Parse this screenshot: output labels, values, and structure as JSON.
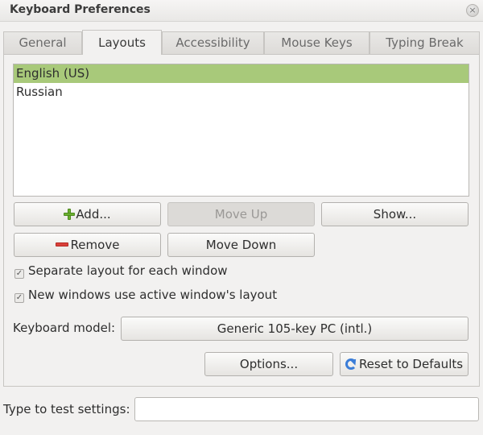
{
  "window": {
    "title": "Keyboard Preferences",
    "close_glyph": "×"
  },
  "tabs": [
    {
      "label": "General"
    },
    {
      "label": "Layouts",
      "active": true
    },
    {
      "label": "Accessibility"
    },
    {
      "label": "Mouse Keys"
    },
    {
      "label": "Typing Break"
    }
  ],
  "layouts": {
    "items": [
      {
        "label": "English (US)",
        "selected": true
      },
      {
        "label": "Russian",
        "selected": false
      }
    ],
    "buttons": {
      "add": "Add...",
      "move_up": "Move Up",
      "show": "Show...",
      "remove": "Remove",
      "move_down": "Move Down"
    },
    "options": {
      "separate_layout": {
        "label": "Separate layout for each window",
        "checked": true
      },
      "new_windows_active": {
        "label": "New windows use active window's layout",
        "checked": true
      }
    },
    "keyboard_model": {
      "label": "Keyboard model:",
      "value": "Generic 105-key PC (intl.)"
    },
    "options_button": "Options...",
    "reset_button": "Reset to Defaults"
  },
  "test": {
    "label": "Type to test settings:",
    "value": ""
  },
  "colors": {
    "selection": "#a8c97a",
    "window_bg": "#f2f1f0"
  },
  "icons": {
    "add": "plus-icon",
    "remove": "minus-icon",
    "reset": "refresh-icon",
    "check": "checkmark-icon"
  }
}
